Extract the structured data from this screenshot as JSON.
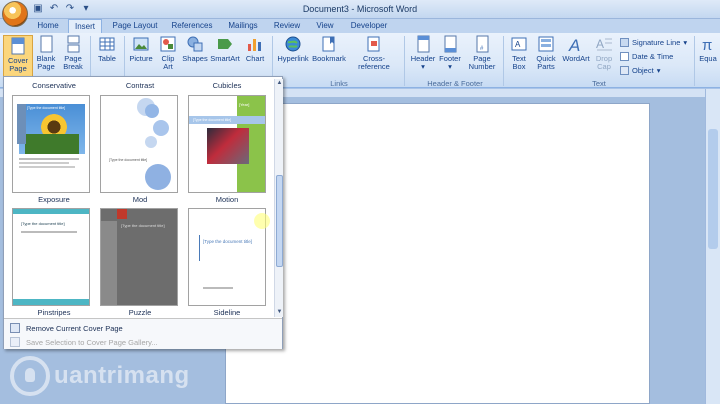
{
  "window": {
    "title": "Document3 - Microsoft Word"
  },
  "qat": {
    "save_icon": "save-icon",
    "undo_icon": "undo-icon",
    "redo_icon": "redo-icon",
    "customize_icon": "chevron-down-icon"
  },
  "tabs": [
    "Home",
    "Insert",
    "Page Layout",
    "References",
    "Mailings",
    "Review",
    "View",
    "Developer"
  ],
  "active_tab": "Insert",
  "ribbon": {
    "cover_page": "Cover Page",
    "blank_page": "Blank Page",
    "page_break": "Page Break",
    "table": "Table",
    "picture": "Picture",
    "clip_art": "Clip Art",
    "shapes": "Shapes",
    "smartart": "SmartArt",
    "chart": "Chart",
    "hyperlink": "Hyperlink",
    "bookmark": "Bookmark",
    "cross_reference": "Cross-reference",
    "header": "Header",
    "footer": "Footer",
    "page_number": "Page Number",
    "text_box": "Text Box",
    "quick_parts": "Quick Parts",
    "wordart": "WordArt",
    "drop_cap": "Drop Cap",
    "signature_line": "Signature Line",
    "date_time": "Date & Time",
    "object": "Object",
    "equation": "Equa",
    "groups": {
      "links": "Links",
      "header_footer": "Header & Footer",
      "text": "Text"
    }
  },
  "gallery": {
    "top_labels": [
      "Conservative",
      "Contrast",
      "Cubicles"
    ],
    "row1_labels": [
      "Exposure",
      "Mod",
      "Motion"
    ],
    "row2_labels": [
      "Pinstripes",
      "Puzzle",
      "Sideline"
    ],
    "thumb_text": {
      "exposure": "[Type the document title]",
      "mod": "[Type the document title]",
      "motion": "[Year]",
      "motion_title": "[Type the document title]",
      "pinstripes": "[Type the document title]",
      "puzzle": "[Type the document title]",
      "sideline": "[Type the document title]"
    },
    "menu": {
      "remove": "Remove Current Cover Page",
      "save": "Save Selection to Cover Page Gallery..."
    }
  },
  "watermark": {
    "text": "uantrimang"
  },
  "colors": {
    "ribbon_accent": "#15428b",
    "motion_green": "#8bc34a",
    "pinstripes_teal": "#4db6c4",
    "puzzle_gray": "#6d6d6d"
  }
}
